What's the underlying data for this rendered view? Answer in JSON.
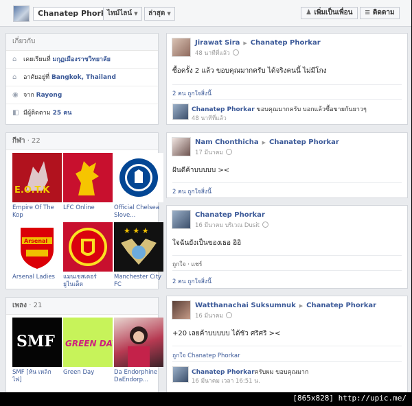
{
  "header": {
    "name": "Chanatep Phorkar",
    "timeline": "ไทม์ไลน์",
    "recent": "ล่าสุด",
    "add_friend": "เพิ่มเป็นเพื่อน",
    "follow": "ติดตาม"
  },
  "about": {
    "title": "เกี่ยวกับ",
    "school_prefix": "เคยเรียนที่",
    "school": "มกุฏเมืองราชวิทยาลัย",
    "lives_prefix": "อาศัยอยู่ที่",
    "lives": "Bangkok, Thailand",
    "from_prefix": "จาก",
    "from": "Rayong",
    "followers_prefix": "มีผู้ติดตาม",
    "followers": "25 คน"
  },
  "sports": {
    "title": "กีฬา",
    "count": "· 22",
    "items": [
      {
        "label": "Empire Of The Kop",
        "icon": "eotk-logo"
      },
      {
        "label": "LFC Online",
        "icon": "liverbird-logo"
      },
      {
        "label": "Official Chelsea Slove...",
        "icon": "chelsea-logo"
      },
      {
        "label": "Arsenal Ladies",
        "icon": "arsenal-logo"
      },
      {
        "label": "แมนเชสเตอร์ ยูไนเต็ด",
        "icon": "manutd-logo"
      },
      {
        "label": "Manchester City FC",
        "icon": "mancity-logo"
      }
    ]
  },
  "music": {
    "title": "เพลง",
    "count": "· 21",
    "items": [
      {
        "label": "SMF [ห้น เหล็ก ไฟ]",
        "icon": "smf-logo"
      },
      {
        "label": "Green Day",
        "icon": "greenday-logo"
      },
      {
        "label": "Da Endorphine DaEndorp...",
        "icon": "artist-photo"
      }
    ]
  },
  "posts": [
    {
      "author": "Jirawat Sira",
      "target": "Chanatep Phorkar",
      "time": "48 นาทีที่แล้ว",
      "text": "ซื้อครั้ง 2 แล้ว ขอบคุณมากครับ ได้จริงคนนี้ ไม่มีโกง",
      "likes": "2 คน ถูกใจสิ่งนี้",
      "comment": {
        "author": "Chanatep Phorkar",
        "text": "ขอบคุณมากครับ บอกแล้วซื้อขายกันยาวๆ",
        "time": "48 นาทีที่แล้ว"
      }
    },
    {
      "author": "Nam Chonthicha",
      "target": "Chanatep Phorkar",
      "time": "17 มีนาคม",
      "text": "ฝันดีค้าบบบบบ ><",
      "likes": "2 คน ถูกใจสิ่งนี้"
    },
    {
      "author": "Chanatep Phorkar",
      "time": "16 มีนาคม บริเวณ Dusit",
      "text": "ใจฉันยังเป็นของเธอ อิอิ",
      "actions": "ถูกใจ · แชร์",
      "likes": "2 คน ถูกใจสิ่งนี้"
    },
    {
      "author": "Watthanachai Suksumnuk",
      "target": "Chanatep Phorkar",
      "time": "16 มีนาคม",
      "text": "+20 เลยค้าบบบบบ ได้ชัว ศริศริ ><",
      "likes_name": "ถูกใจ Chanatep Phorkar",
      "comment": {
        "author": "Chanatep Phorkar",
        "text": "ครับผม ขอบคุณมาก",
        "time": "16 มีนาคม เวลา 16:51 น."
      }
    }
  ],
  "watermark": "[865x828] http://upic.me/",
  "colors": {
    "link": "#3b5998",
    "background": "#e9ebee",
    "panel_header": "#f6f7f9"
  }
}
